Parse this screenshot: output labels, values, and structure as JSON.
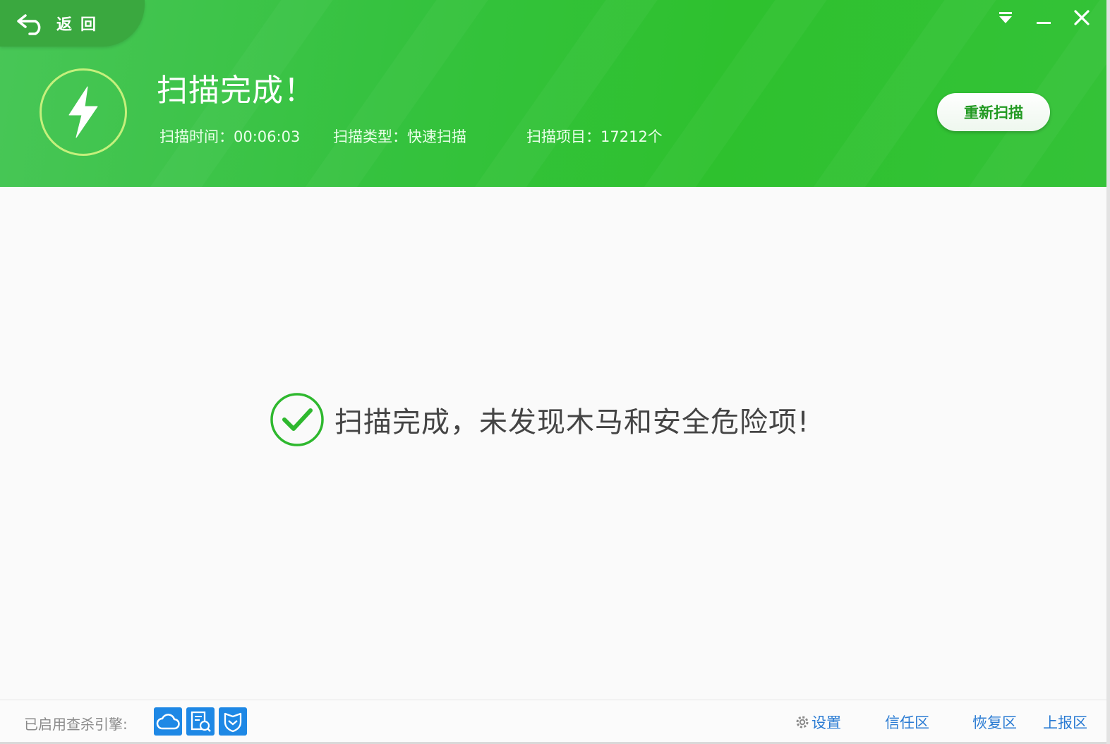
{
  "header": {
    "back_label": "返回",
    "title": "扫描完成！",
    "meta": {
      "time_label": "扫描时间：00:06:03",
      "type_label": "扫描类型：快速扫描",
      "items_label": "扫描项目：17212个"
    },
    "rescan_label": "重新扫描"
  },
  "window_controls": {
    "menu_icon": "menu-down-icon",
    "minimize_icon": "minimize-icon",
    "close_icon": "close-icon"
  },
  "main": {
    "result_message": "扫描完成，未发现木马和安全危险项!",
    "result_icon": "check-circle-icon"
  },
  "footer": {
    "engines_label": "已启用查杀引擎:",
    "engines": [
      "cloud-engine-icon",
      "qvm-engine-icon",
      "defense-engine-icon"
    ],
    "links": {
      "settings": "设置",
      "trust": "信任区",
      "restore": "恢复区",
      "report": "上报区"
    }
  },
  "colors": {
    "header_green": "#35c23f",
    "accent_green": "#2eb82e",
    "link_blue": "#2a7bd3",
    "engine_blue": "#1e88e5"
  }
}
